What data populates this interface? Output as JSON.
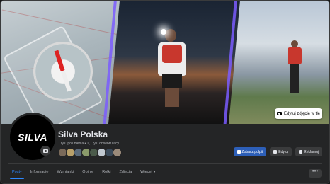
{
  "cover": {
    "edit_label": "Edytuj zdjęcie w tle"
  },
  "profile": {
    "avatar_text": "SILVA",
    "name": "Silva Polska",
    "stats": "1 tys. polubienia • 1,1 tys. obserwujący"
  },
  "actions": {
    "view_dashboard": "Zobacz pulpit",
    "edit": "Edytuj",
    "advertise": "Reklamuj"
  },
  "tabs": [
    {
      "label": "Posty"
    },
    {
      "label": "Informacje"
    },
    {
      "label": "Wzmianki"
    },
    {
      "label": "Opinie"
    },
    {
      "label": "Rolki"
    },
    {
      "label": "Zdjęcia"
    },
    {
      "label": "Więcej"
    }
  ],
  "more_label": "•••",
  "colors": {
    "accent": "#2d88ff",
    "primary_button": "#2d5fb8",
    "background": "#242526"
  }
}
